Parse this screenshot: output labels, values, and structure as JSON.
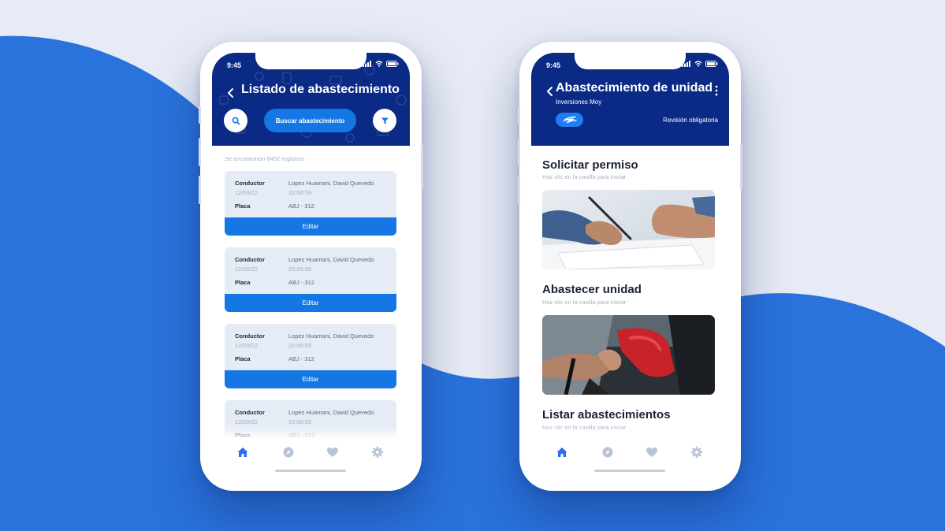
{
  "colors": {
    "brand_navy": "#0b2a86",
    "accent_blue": "#1577e4",
    "background_blue": "#2a72dc"
  },
  "left_phone": {
    "status_time": "9:45",
    "title": "Listado de abastecimiento",
    "search_button_label": "Buscar abastecimiento",
    "records_found": "Se encontraron 6452 registros",
    "cards": [
      {
        "driver_label": "Conductor",
        "driver_name": "Lopez Huamani, David Quevedo",
        "date": "12/09/22",
        "time": "20:08:59",
        "plate_label": "Placa",
        "plate": "ABJ - 312",
        "edit_label": "Editar"
      },
      {
        "driver_label": "Conductor",
        "driver_name": "Lopez Huamani, David Quevedo",
        "date": "12/09/22",
        "time": "20:08:59",
        "plate_label": "Placa",
        "plate": "ABJ - 312",
        "edit_label": "Editar"
      },
      {
        "driver_label": "Conductor",
        "driver_name": "Lopez Huamani, David Quevedo",
        "date": "12/09/22",
        "time": "20:08:59",
        "plate_label": "Placa",
        "plate": "ABJ - 312",
        "edit_label": "Editar"
      },
      {
        "driver_label": "Conductor",
        "driver_name": "Lopez Huamani, David Quevedo",
        "date": "12/09/22",
        "time": "20:08:59",
        "plate_label": "Placa",
        "plate": "ABJ - 312"
      }
    ],
    "tabs": [
      "home-icon",
      "compass-icon",
      "heart-icon",
      "gear-icon"
    ]
  },
  "right_phone": {
    "status_time": "9:45",
    "title": "Abastecimiento de unidad",
    "company": "Inversiones Moy",
    "badge": "Revisión obligatoria",
    "sections": [
      {
        "title": "Solicitar permiso",
        "hint": "Haz clic en la casilla para iniciar",
        "image": "signing-document-photo"
      },
      {
        "title": "Abastecer unidad",
        "hint": "Haz clic en la casilla para iniciar",
        "image": "fuel-nozzle-photo"
      },
      {
        "title": "Listar abastecimientos",
        "hint": "Haz clic en la casilla para iniciar"
      }
    ],
    "tabs": [
      "home-icon",
      "compass-icon",
      "heart-icon",
      "gear-icon"
    ]
  }
}
